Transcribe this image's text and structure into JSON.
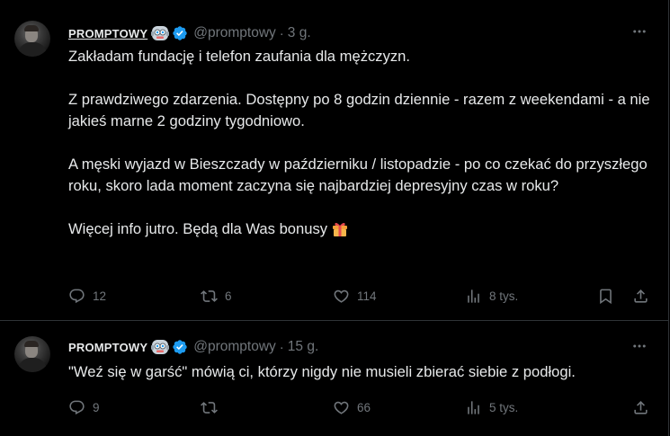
{
  "tweets": [
    {
      "display_name": "PROMPTOWY",
      "handle": "@promptowy",
      "dot": "·",
      "time": "3 g.",
      "paragraphs": [
        "Zakładam fundację i telefon zaufania dla mężczyzn.",
        "Z prawdziwego zdarzenia. Dostępny po 8 godzin dziennie - razem z weekendami - a nie jakieś marne 2 godziny tygodniowo.",
        "A męski wyjazd w Bieszczady w październiku / listopadzie - po co czekać do przyszłego roku, skoro lada moment zaczyna się najbardziej depresyjny czas w roku?",
        "Więcej info jutro. Będą dla Was bonusy"
      ],
      "replies": "12",
      "retweets": "6",
      "likes": "114",
      "views": "8 tys."
    },
    {
      "display_name": "PROMPTOWY",
      "handle": "@promptowy",
      "dot": "·",
      "time": "15 g.",
      "paragraphs": [
        "\"Weź się w garść\" mówią ci, którzy nigdy nie musieli zbierać siebie z podłogi."
      ],
      "replies": "9",
      "retweets": "",
      "likes": "66",
      "views": "5 tys."
    }
  ],
  "icons": {
    "verified": "verified-badge-icon",
    "emoji": "robot-emoji-icon",
    "gift": "gift-emoji-icon",
    "more": "more-options-icon",
    "reply": "reply-icon",
    "retweet": "retweet-icon",
    "like": "heart-icon",
    "views": "views-icon",
    "bookmark": "bookmark-icon",
    "share": "share-icon"
  },
  "colors": {
    "background": "#000000",
    "text": "#e7e9ea",
    "muted": "#71767b",
    "verified": "#1d9bf0",
    "divider": "#2f3336"
  }
}
